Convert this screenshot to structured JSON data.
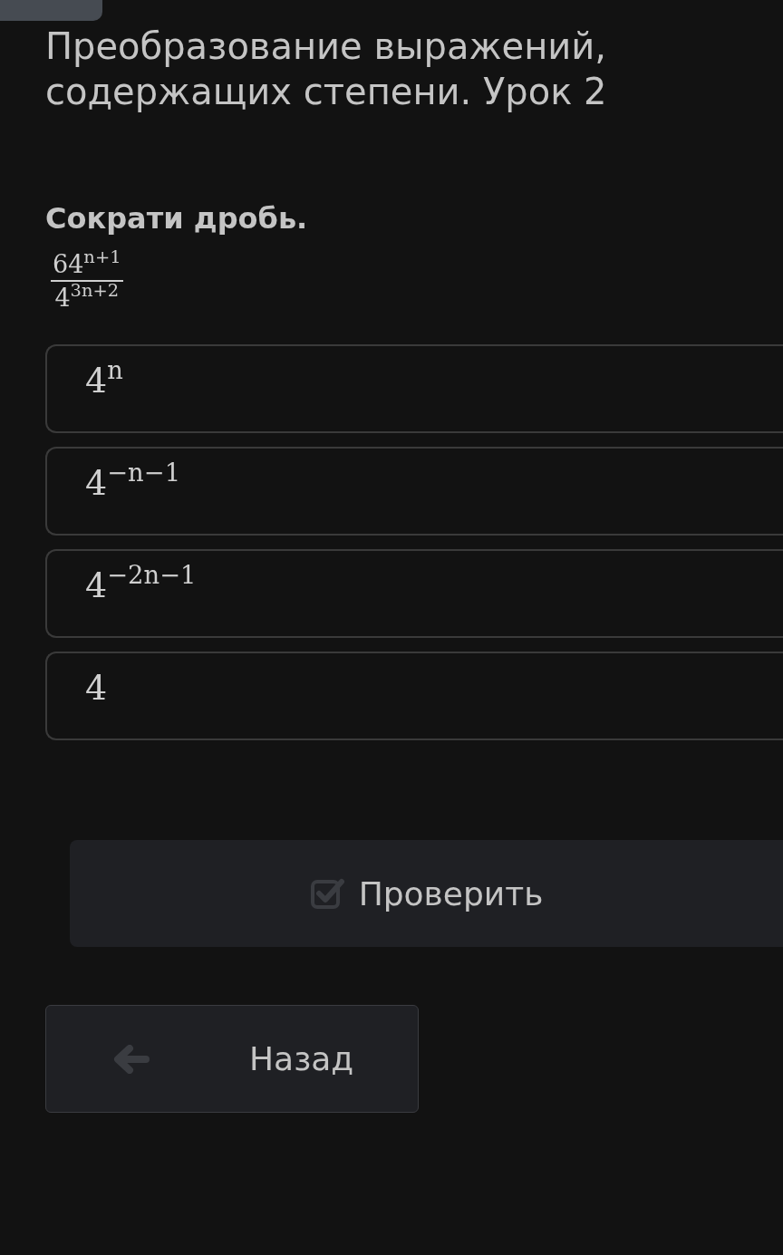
{
  "title": "Преобразование выражений, содержащих степени. Урок 2",
  "question": "Сократи дробь.",
  "fraction": {
    "numerator": "64$^{n+1}$",
    "denominator": "4$^{3n+2}$"
  },
  "options": [
    {
      "text": "4$^{n}$",
      "selected": false
    },
    {
      "text": "4$^{−n−1}$",
      "selected": false
    },
    {
      "text": "4$^{−2n−1}$",
      "selected": false
    },
    {
      "text": "4",
      "selected": false
    }
  ],
  "check_button": {
    "label": "Проверить",
    "disabled": true
  },
  "back_button": {
    "label": "Назад"
  }
}
